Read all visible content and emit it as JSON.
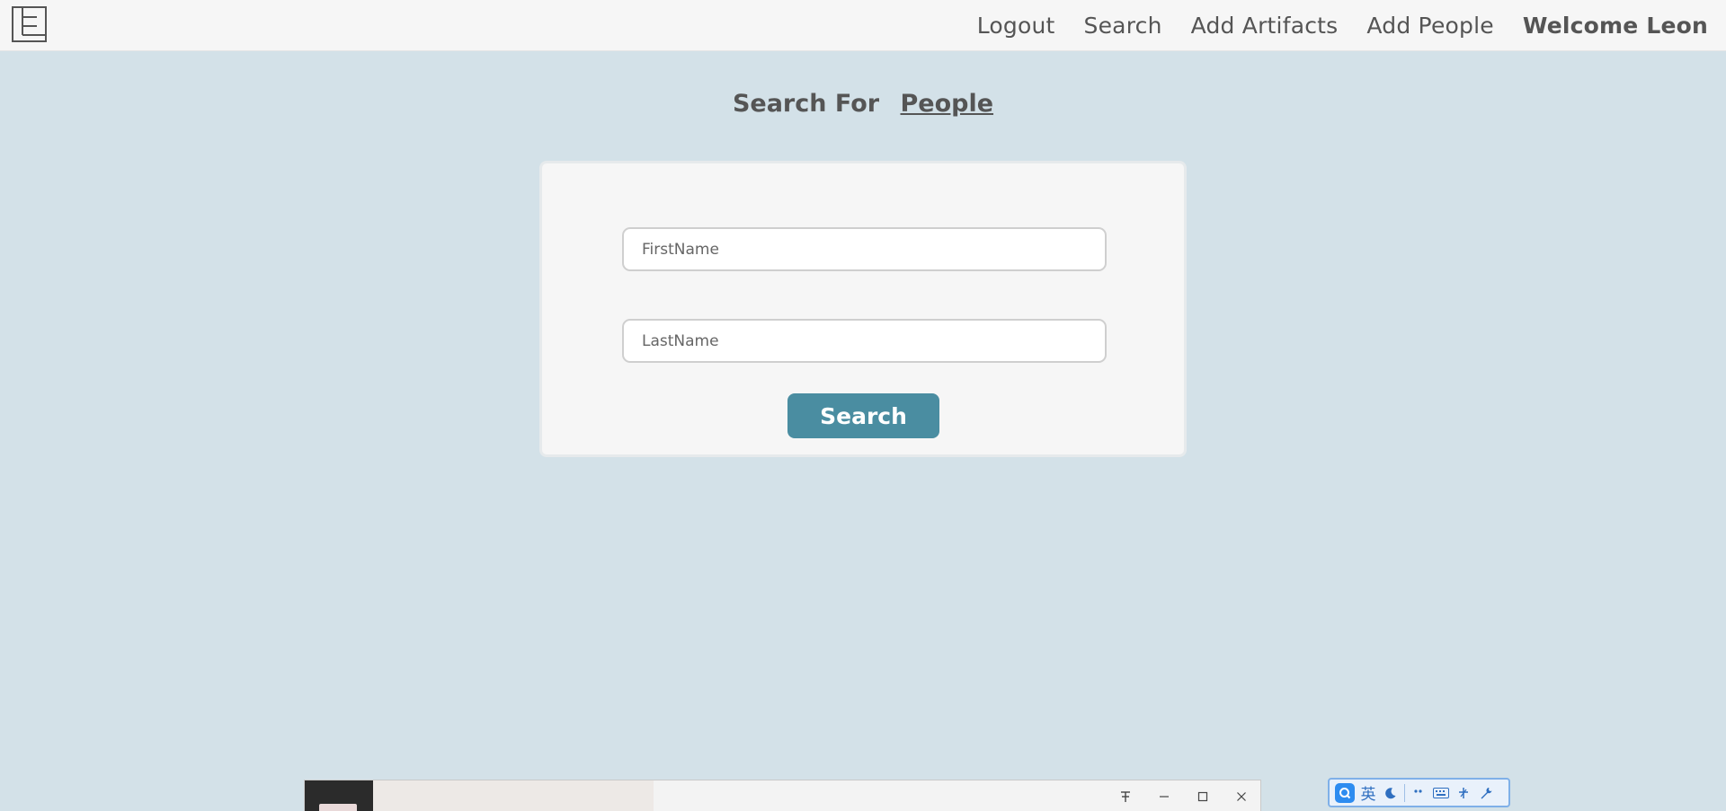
{
  "navbar": {
    "logo_icon": "logo-icon",
    "links": {
      "logout": "Logout",
      "search": "Search",
      "add_artifacts": "Add Artifacts",
      "add_people": "Add People"
    },
    "welcome": "Welcome Leon"
  },
  "heading": {
    "prefix": "Search For",
    "link": "People"
  },
  "form": {
    "first_name_placeholder": "FirstName",
    "first_name_value": "",
    "last_name_placeholder": "LastName",
    "last_name_value": "",
    "search_button": "Search"
  },
  "colors": {
    "page_background": "#d3e1e8",
    "nav_background": "#f6f6f6",
    "card_background": "#f6f6f6",
    "button": "#4a8da1",
    "text": "#555555"
  },
  "taskbar_window": {
    "controls": {
      "pin": "pin-icon",
      "minimize": "minimize-icon",
      "maximize": "maximize-icon",
      "close": "close-icon"
    }
  },
  "ime_toolbar": {
    "language": "英",
    "icons": [
      "ime-logo-icon",
      "moon-icon",
      "punctuation-icon",
      "keyboard-icon",
      "half-width-icon",
      "wrench-icon"
    ]
  }
}
